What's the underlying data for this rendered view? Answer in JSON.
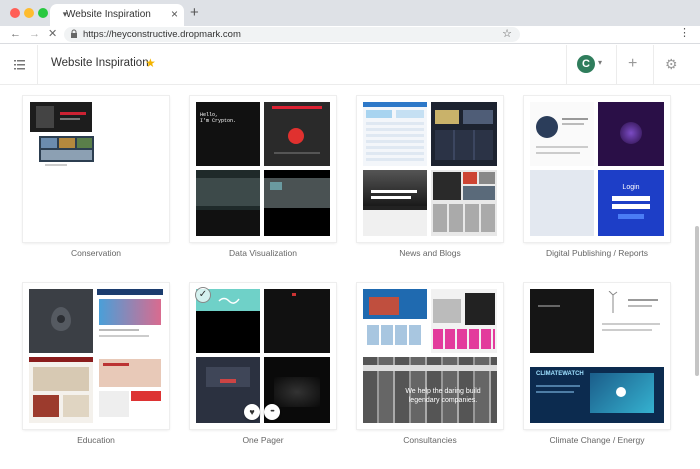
{
  "browser": {
    "tab_title": "Website Inspiration",
    "tab_close": "×",
    "new_tab": "+",
    "url": "https://heyconstructive.dropmark.com",
    "nav_back": "←",
    "nav_forward": "→",
    "nav_stop": "✕",
    "bookmark_star": "☆",
    "menu": "⋮"
  },
  "app": {
    "title": "Website Inspiration",
    "title_star": "★",
    "avatar_letter": "C",
    "avatar_chevron": "▾",
    "add": "+",
    "settings": "⚙"
  },
  "collections": [
    {
      "label": "Conservation"
    },
    {
      "label": "Data Visualization"
    },
    {
      "label": "News and Blogs"
    },
    {
      "label": "Digital Publishing / Reports"
    },
    {
      "label": "Education"
    },
    {
      "label": "One Pager"
    },
    {
      "label": "Consultancies"
    },
    {
      "label": "Climate Change / Energy"
    }
  ],
  "thumb_text": {
    "dataviz_hello": "Hello,\nI'm Crypton.",
    "digital_login": "Login",
    "consult_tagline": "We help the daring build legendary companies.",
    "climate_brand": "CLIMATEWATCH"
  },
  "hover": {
    "check": "✓",
    "heart": "♥",
    "more": "•••"
  },
  "colors": {
    "accent_green": "#2f7d5c",
    "star_yellow": "#f4b400"
  }
}
